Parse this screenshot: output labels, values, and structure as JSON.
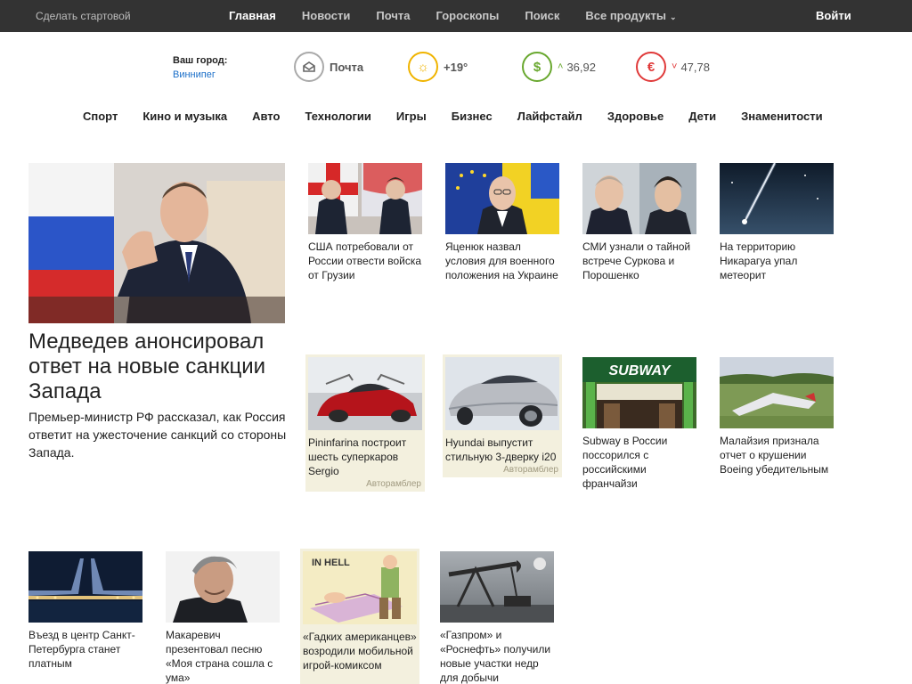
{
  "topbar": {
    "home_link": "Сделать стартовой",
    "nav": [
      "Главная",
      "Новости",
      "Почта",
      "Гороскопы",
      "Поиск",
      "Все продукты"
    ],
    "login": "Войти"
  },
  "widgets": {
    "city_label": "Ваш город:",
    "city_value": "Виннипег",
    "mail_label": "Почта",
    "weather_value": "+19°",
    "usd_value": "36,92",
    "eur_value": "47,78",
    "colors": {
      "mail": "#aaaaaa",
      "weather": "#f0b400",
      "usd": "#69a82f",
      "eur": "#e03a3a"
    }
  },
  "categories": [
    "Спорт",
    "Кино и музыка",
    "Авто",
    "Технологии",
    "Игры",
    "Бизнес",
    "Лайфстайл",
    "Здоровье",
    "Дети",
    "Знаменитости"
  ],
  "main_story": {
    "title": "Медведев анонсировал ответ на новые санкции Запада",
    "lead": "Премьер-министр РФ рассказал, как Россия ответит на ужесточение санкций со стороны Запада."
  },
  "news": [
    {
      "caption": "США потребовали от России отвести войска от Грузии"
    },
    {
      "caption": "Яценюк назвал условия для военного положения на Украине"
    },
    {
      "caption": "СМИ узнали о тайной встрече Суркова и Порошенко"
    },
    {
      "caption": "На территорию Никарагуа упал метеорит"
    },
    {
      "caption": "Pininfarina построит шесть суперкаров Sergio",
      "source": "Авторамблер"
    },
    {
      "caption": "Hyundai выпустит стильную 3-дверку i20",
      "source": "Авторамблер"
    },
    {
      "caption": "Subway в России поссорился с российскими франчайзи"
    },
    {
      "caption": "Малайзия признала отчет о крушении Boeing убедительным"
    },
    {
      "caption": "Въезд в центр Санкт-Петербурга станет платным"
    },
    {
      "caption": "Макаревич презентовал песню «Моя страна сошла с ума»"
    },
    {
      "caption": "«Гадких американцев» возродили мобильной игрой-комиксом"
    },
    {
      "caption": "«Газпром» и «Роснефть» получили новые участки недр для добычи"
    }
  ],
  "image_text": {
    "subway_logo": "SUBWAY",
    "comic_text": "IN HELL"
  }
}
